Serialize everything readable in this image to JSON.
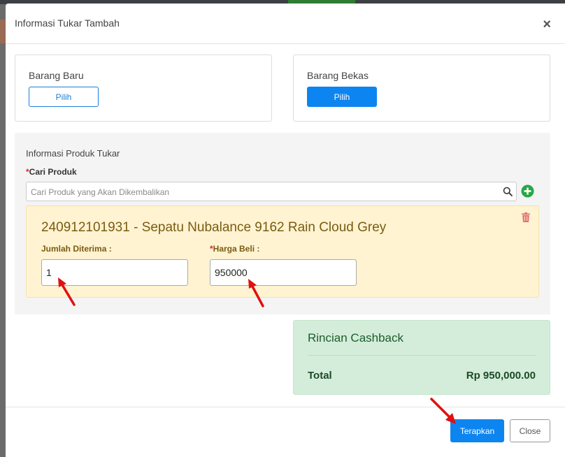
{
  "modal": {
    "title": "Informasi Tukar Tambah",
    "close_glyph": "×"
  },
  "new_item": {
    "label": "Barang Baru",
    "button": "Pilih"
  },
  "used_item": {
    "label": "Barang Bekas",
    "button": "Pilih"
  },
  "exchange": {
    "section_title": "Informasi Produk Tukar",
    "required_mark": "*",
    "search_label": "Cari Produk",
    "search_placeholder": "Cari Produk yang Akan Dikembalikan",
    "search_value": ""
  },
  "product": {
    "title": "240912101931 - Sepatu Nubalance 9162 Rain Cloud Grey",
    "qty_label": "Jumlah Diterima :",
    "qty_value": "1",
    "price_required_mark": "*",
    "price_label": "Harga Beli :",
    "price_value": "950000"
  },
  "cashback": {
    "title": "Rincian Cashback",
    "total_label": "Total",
    "total_value": "Rp 950,000.00"
  },
  "footer": {
    "apply_label": "Terapkan",
    "close_label": "Close"
  },
  "colors": {
    "primary": "#0d85f0",
    "warning_bg": "#fff3d1",
    "success_bg": "#d4edda",
    "danger": "#d9232e",
    "annotation_arrow": "#e01010"
  },
  "icons": {
    "search": "magnifier",
    "add": "plus-circle",
    "delete": "trash",
    "close": "x"
  }
}
